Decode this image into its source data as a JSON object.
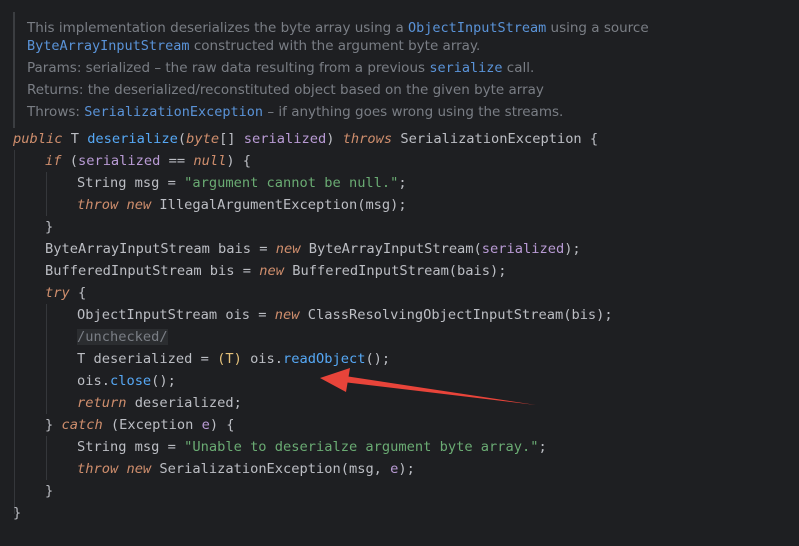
{
  "doc": {
    "line1_a": "This implementation deserializes the byte array using a ",
    "line1_code": "ObjectInputStream",
    "line1_b": " using a source",
    "line2_code": "ByteArrayInputStream",
    "line2_b": " constructed with the argument byte array.",
    "params_label": "Params:",
    "params_a": "serialized – the raw data resulting from a previous ",
    "params_code": "serialize",
    "params_b": " call.",
    "returns_label": "Returns:",
    "returns_text": "the deserialized/reconstituted object based on the given byte array",
    "throws_label": "Throws:",
    "throws_code": "SerializationException",
    "throws_text": " – if anything goes wrong using the streams."
  },
  "code": {
    "l1": [
      "public",
      " T ",
      "deserialize",
      "(",
      "byte",
      "[] ",
      "serialized",
      ") ",
      "throws",
      " SerializationException {"
    ],
    "l2": [
      "if",
      " (",
      "serialized",
      " == ",
      "null",
      ") {"
    ],
    "l3": [
      "String msg = ",
      "\"argument cannot be null.\"",
      ";"
    ],
    "l4": [
      "throw",
      " ",
      "new",
      " IllegalArgumentException(msg);"
    ],
    "l5": [
      "}"
    ],
    "l6": [
      "ByteArrayInputStream bais = ",
      "new",
      " ByteArrayInputStream(",
      "serialized",
      ");"
    ],
    "l7": [
      "BufferedInputStream bis = ",
      "new",
      " BufferedInputStream(bais);"
    ],
    "l8": [
      "try",
      " {"
    ],
    "l9": [
      "ObjectInputStream ois = ",
      "new",
      " ClassResolvingObjectInputStream(bis);"
    ],
    "l10": [
      "/unchecked/"
    ],
    "l11": [
      "T deserialized = ",
      "(T)",
      " ois.",
      "readObject",
      "();"
    ],
    "l12": [
      "ois.",
      "close",
      "();"
    ],
    "l13": [
      "return",
      " deserialized;"
    ],
    "l14": [
      "} ",
      "catch",
      " (Exception ",
      "e",
      ") {"
    ],
    "l15": [
      "String msg = ",
      "\"Unable to deserialze argument byte array.\"",
      ";"
    ],
    "l16": [
      "throw",
      " ",
      "new",
      " SerializationException(msg, ",
      "e",
      ");"
    ],
    "l17": [
      "}"
    ],
    "l18": [
      "}"
    ]
  },
  "colors": {
    "background": "#1e1f22",
    "keyword": "#cf8e6d",
    "string": "#6aab73",
    "method": "#56a8f5",
    "parameter": "#b99bd5",
    "annotation_arrow": "#e8443a"
  }
}
